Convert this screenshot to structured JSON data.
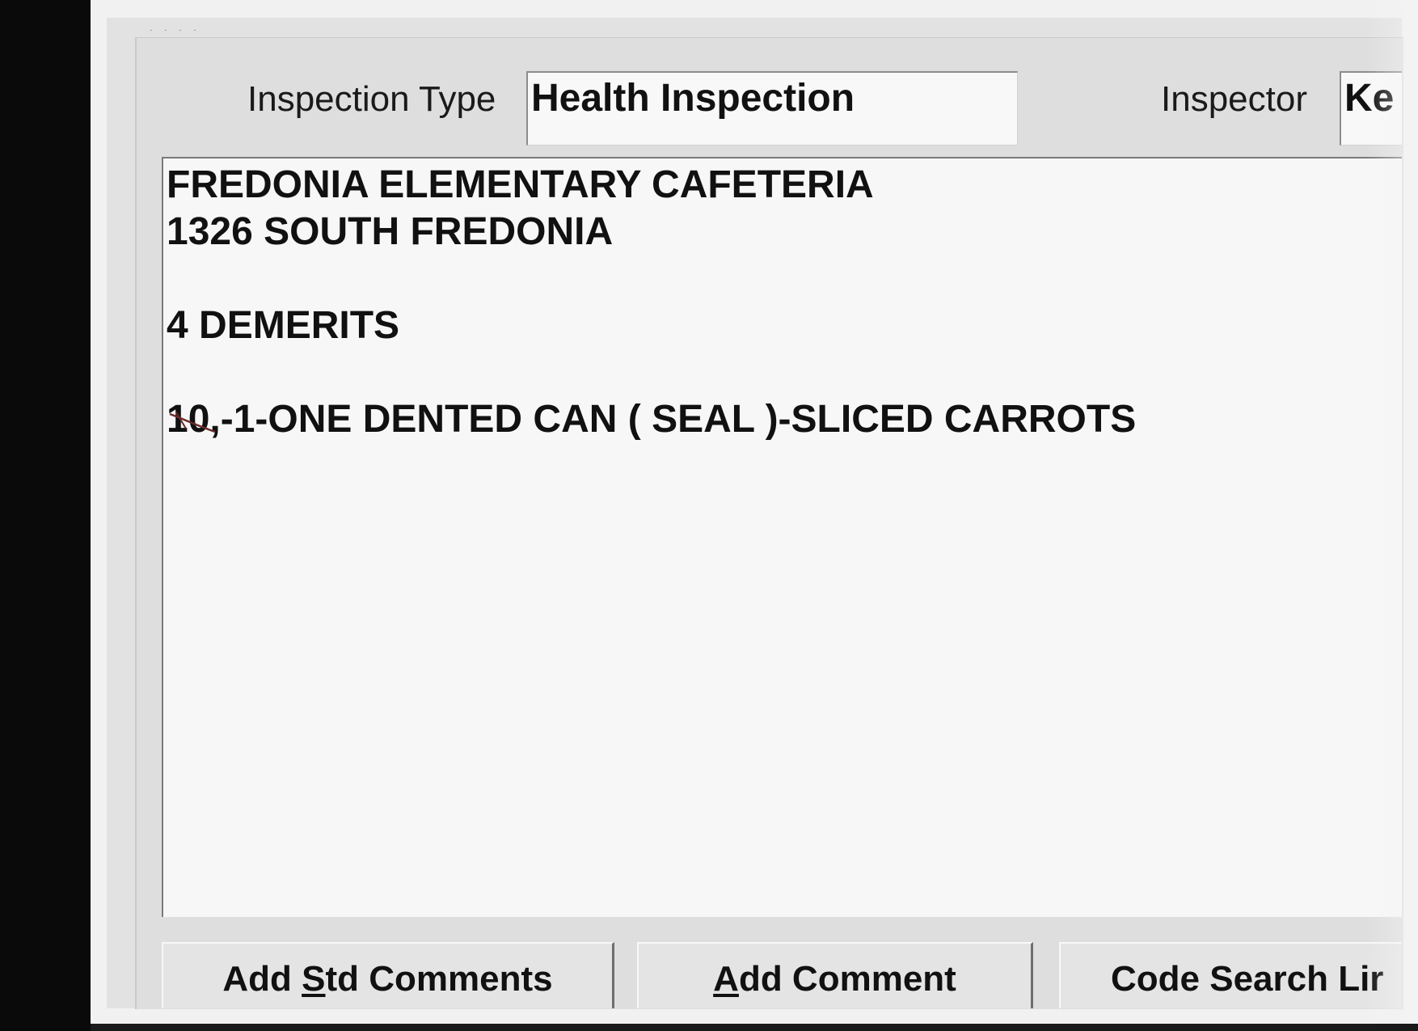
{
  "header": {
    "inspection_type_label": "Inspection Type",
    "inspection_type_value": "Health Inspection",
    "inspector_label": "Inspector",
    "inspector_value": "Ke"
  },
  "comments": {
    "line1": "FREDONIA ELEMENTARY CAFETERIA",
    "line2": "1326 SOUTH FREDONIA",
    "line3": "4 DEMERITS",
    "violation_number": "10,",
    "violation_text": "-1-ONE DENTED CAN ( SEAL )-SLICED CARROTS"
  },
  "buttons": {
    "add_std_comments": {
      "before": "Add ",
      "accel": "S",
      "after": "td Comments"
    },
    "add_comment": {
      "before": "",
      "accel": "A",
      "after": "dd Comment"
    },
    "code_search": {
      "label": "Code Search Lir"
    }
  },
  "colors": {
    "scanner_border": "#0a0a0a",
    "paper": "#f1f1f1",
    "window_face": "#e2e2e2",
    "text_area": "#f7f7f7",
    "handwritten_mark": "#6b2a2a"
  }
}
